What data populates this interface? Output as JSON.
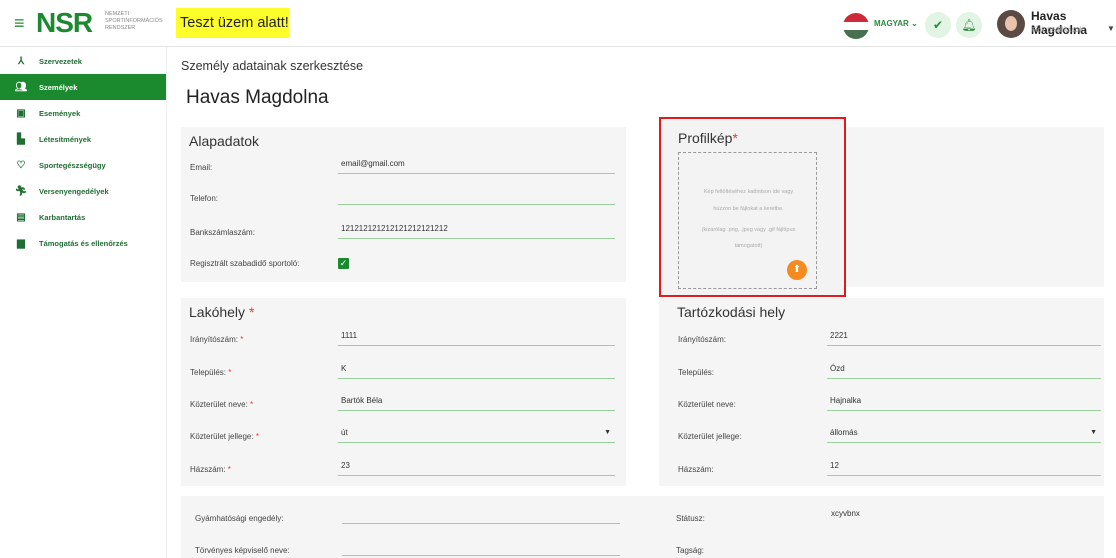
{
  "header": {
    "logo_text": "NSR",
    "logo_sub": "NEMZETI SPORTINFORMÁCIÓS RENDSZER",
    "test_banner": "Teszt üzem alatt!",
    "language": "MAGYAR",
    "user_name": "Havas Magdolna",
    "user_sub": "Fiók beállítások",
    "flag_colors": [
      "#ce2939",
      "#ffffff",
      "#477050"
    ]
  },
  "sidebar": {
    "items": [
      {
        "label": "Szervezetek",
        "icon": "organization-icon"
      },
      {
        "label": "Személyek",
        "icon": "people-icon"
      },
      {
        "label": "Események",
        "icon": "calendar-icon"
      },
      {
        "label": "Létesítmények",
        "icon": "building-icon"
      },
      {
        "label": "Sportegészségügy",
        "icon": "heart-icon"
      },
      {
        "label": "Versenyengedélyek",
        "icon": "runner-icon"
      },
      {
        "label": "Karbantartás",
        "icon": "clipboard-icon"
      },
      {
        "label": "Támogatás és ellenőrzés",
        "icon": "briefcase-icon"
      }
    ],
    "active_index": 1
  },
  "page": {
    "subtitle": "Személy adatainak szerkesztése",
    "title": "Havas Magdolna"
  },
  "alapadatok": {
    "title": "Alapadatok",
    "email_label": "Email:",
    "email_value": "email@gmail.com",
    "phone_label": "Telefon:",
    "phone_value": "",
    "bank_label": "Bankszámlaszám:",
    "bank_value": "121212121212121212121212",
    "registered_label": "Regisztrált szabadidő sportoló:",
    "registered_checked": true
  },
  "profile": {
    "title": "Profilkép",
    "hint_line1": "Kép feltöltéséhez kattintson ide vagy",
    "hint_line2": "húzzon be fájlokat a keretbe.",
    "hint_line3": "(kizárólag .png, .jpeg vagy .gif fájltípus",
    "hint_line4": "támogatott)"
  },
  "lakohely": {
    "title": "Lakóhely",
    "zip_label": "Irányítószám:",
    "zip_value": "1111",
    "city_label": "Település:",
    "city_value": "K",
    "street_label": "Közterület neve:",
    "street_value": "Bartók Béla",
    "street_type_label": "Közterület jellege:",
    "street_type_value": "út",
    "house_label": "Házszám:",
    "house_value": "23"
  },
  "tartozkodasi": {
    "title": "Tartózkodási hely",
    "zip_label": "Irányítószám:",
    "zip_value": "2221",
    "city_label": "Település:",
    "city_value": "Ózd",
    "street_label": "Közterület neve:",
    "street_value": "Hajnalka",
    "street_type_label": "Közterület jellege:",
    "street_type_value": "állomás",
    "house_label": "Házszám:",
    "house_value": "12"
  },
  "bottom": {
    "guardian_label": "Gyámhatósági engedély:",
    "guardian_value": "",
    "representative_label": "Törvényes képviselő neve:",
    "representative_value": "",
    "status_label": "Státusz:",
    "status_value": "xcyvbnx",
    "membership_label": "Tagság:",
    "membership_value": ""
  },
  "colors": {
    "brand_green": "#1b8a2e",
    "required_red": "#e53935",
    "highlight_red": "#e01b1b",
    "upload_orange": "#f58b1f",
    "test_yellow": "#fdfd2a"
  }
}
